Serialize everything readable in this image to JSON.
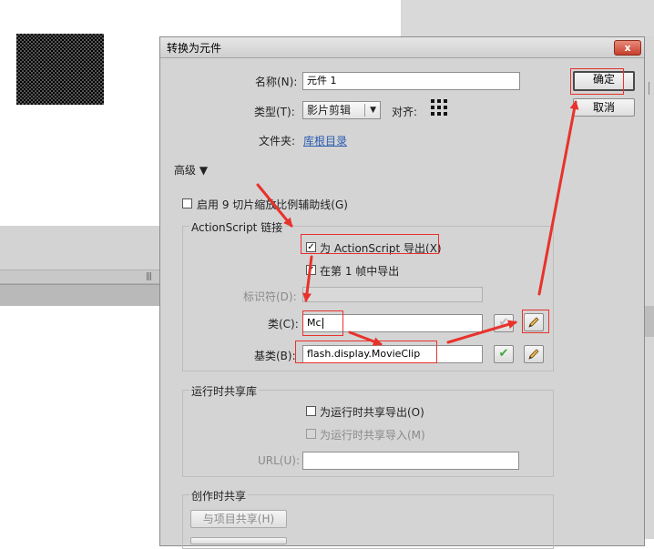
{
  "dialog": {
    "title": "转换为元件",
    "close_label": "x",
    "name_label": "名称(N):",
    "name_value": "元件 1",
    "type_label": "类型(T):",
    "type_value": "影片剪辑",
    "align_label": "对齐:",
    "folder_label": "文件夹:",
    "folder_link": "库根目录",
    "advanced_label": "高级 ▼",
    "ok_label": "确定",
    "cancel_label": "取消",
    "scale9_label": "启用 9 切片缩放比例辅助线(G)",
    "actionscript": {
      "group_title": "ActionScript 链接",
      "export_as_label": "为 ActionScript 导出(X)",
      "export_frame1_label": "在第 1 帧中导出",
      "identifier_label": "标识符(D):",
      "identifier_value": "",
      "class_label": "类(C):",
      "class_value": "Mc",
      "base_class_label": "基类(B):",
      "base_class_value": "flash.display.MovieClip",
      "check_mark": "✔"
    },
    "runtime": {
      "group_title": "运行时共享库",
      "export_label": "为运行时共享导出(O)",
      "import_label": "为运行时共享导入(M)",
      "url_label": "URL(U):",
      "url_value": ""
    },
    "authortime": {
      "group_title": "创作时共享",
      "share_button": "与项目共享(H)"
    }
  },
  "stage": {
    "scroll_grip": "|||"
  },
  "colors": {
    "dialog_bg": "#d4d4d4",
    "annotation_red": "#e8322c",
    "link_blue": "#2a5db0",
    "check_green": "#3fa83a"
  }
}
